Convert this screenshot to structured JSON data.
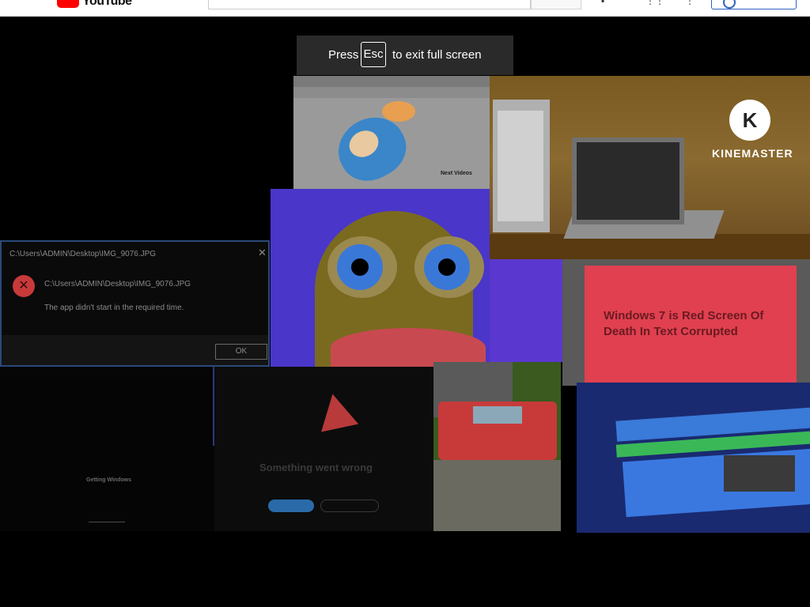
{
  "app": {
    "name": "YouTube",
    "logo_text": "YouTube"
  },
  "header": {
    "search_placeholder": "",
    "icons": [
      "mic-icon",
      "create-icon",
      "apps-icon",
      "more-icon"
    ],
    "signin_label": ""
  },
  "fullscreen_toast": {
    "prefix": "Press",
    "key": "Esc",
    "suffix": "to exit full screen"
  },
  "video": {
    "watermark": {
      "logo_letter": "K",
      "text": "KINEMASTER"
    },
    "tiles": {
      "error_dialog": {
        "title": "C:\\Users\\ADMIN\\Desktop\\IMG_9076.JPG",
        "path": "C:\\Users\\ADMIN\\Desktop\\IMG_9076.JPG",
        "message": "The app didn't start in the required time.",
        "ok_label": "OK"
      },
      "red_screen": {
        "text": "Windows 7 is Red Screen Of Death In Text Corrupted"
      },
      "something_wrong": {
        "heading": "Something went wrong"
      },
      "dark_tile": {
        "text": "Getting Windows"
      },
      "pocoyo": {
        "label": "Next Videos"
      }
    }
  },
  "colors": {
    "brand": "#ff0000",
    "toast_bg": "#2a2a2a",
    "page_bg": "#000000"
  }
}
